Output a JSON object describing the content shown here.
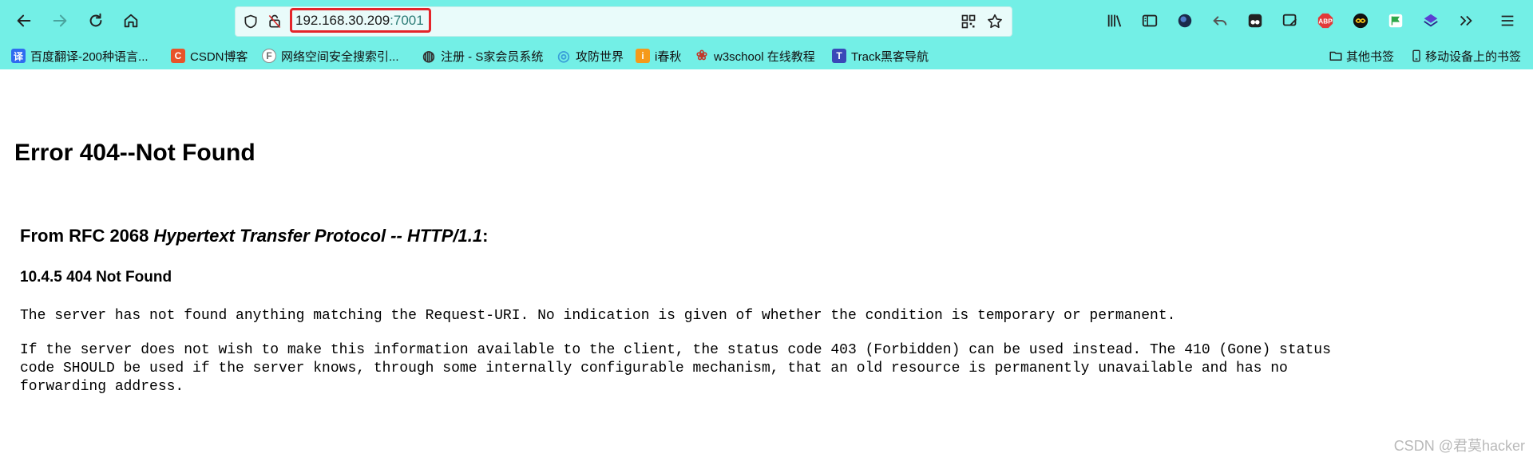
{
  "url": {
    "host": "192.168.30.209",
    "port": ":7001"
  },
  "bookmarks": [
    {
      "label": "百度翻译-200种语言...",
      "icon": "translate-icon",
      "color": "#2f6bf0",
      "glyph": "译"
    },
    {
      "label": "CSDN博客",
      "icon": "csdn-icon",
      "color": "#e8532a",
      "glyph": "C"
    },
    {
      "label": "网络空间安全搜索引...",
      "icon": "fofa-icon",
      "color": "#6b6b6b",
      "glyph": "F"
    },
    {
      "label": "注册 - S家会员系统",
      "icon": "globe-icon",
      "color": "#333333",
      "glyph": "◍"
    },
    {
      "label": "攻防世界",
      "icon": "adworld-icon",
      "color": "#3aa0d8",
      "glyph": "◎"
    },
    {
      "label": "i春秋",
      "icon": "ichunqiu-icon",
      "color": "#f59a1a",
      "glyph": "i"
    },
    {
      "label": "w3school 在线教程",
      "icon": "w3school-icon",
      "color": "#c0392b",
      "glyph": "❀"
    },
    {
      "label": "Track黑客导航",
      "icon": "track-icon",
      "color": "#3a47b8",
      "glyph": "T"
    }
  ],
  "other_bookmarks": "其他书签",
  "mobile_bookmarks": "移动设备上的书签",
  "page": {
    "title": "Error 404--Not Found",
    "rfc_prefix": "From RFC 2068 ",
    "rfc_title": "Hypertext Transfer Protocol -- HTTP/1.1",
    "rfc_suffix": ":",
    "section": "10.4.5 404 Not Found",
    "para1": "The server has not found anything matching the Request-URI. No indication is given of whether the condition is temporary or permanent.",
    "para2_line1": "If the server does not wish to make this information available to the client, the status code 403 (Forbidden) can be used instead. The 410 (Gone) status",
    "para2_line2": "code SHOULD be used if the server knows, through some internally configurable mechanism, that an old resource is permanently unavailable and has no",
    "para2_line3": "forwarding address."
  },
  "watermark": "CSDN @君莫hacker"
}
